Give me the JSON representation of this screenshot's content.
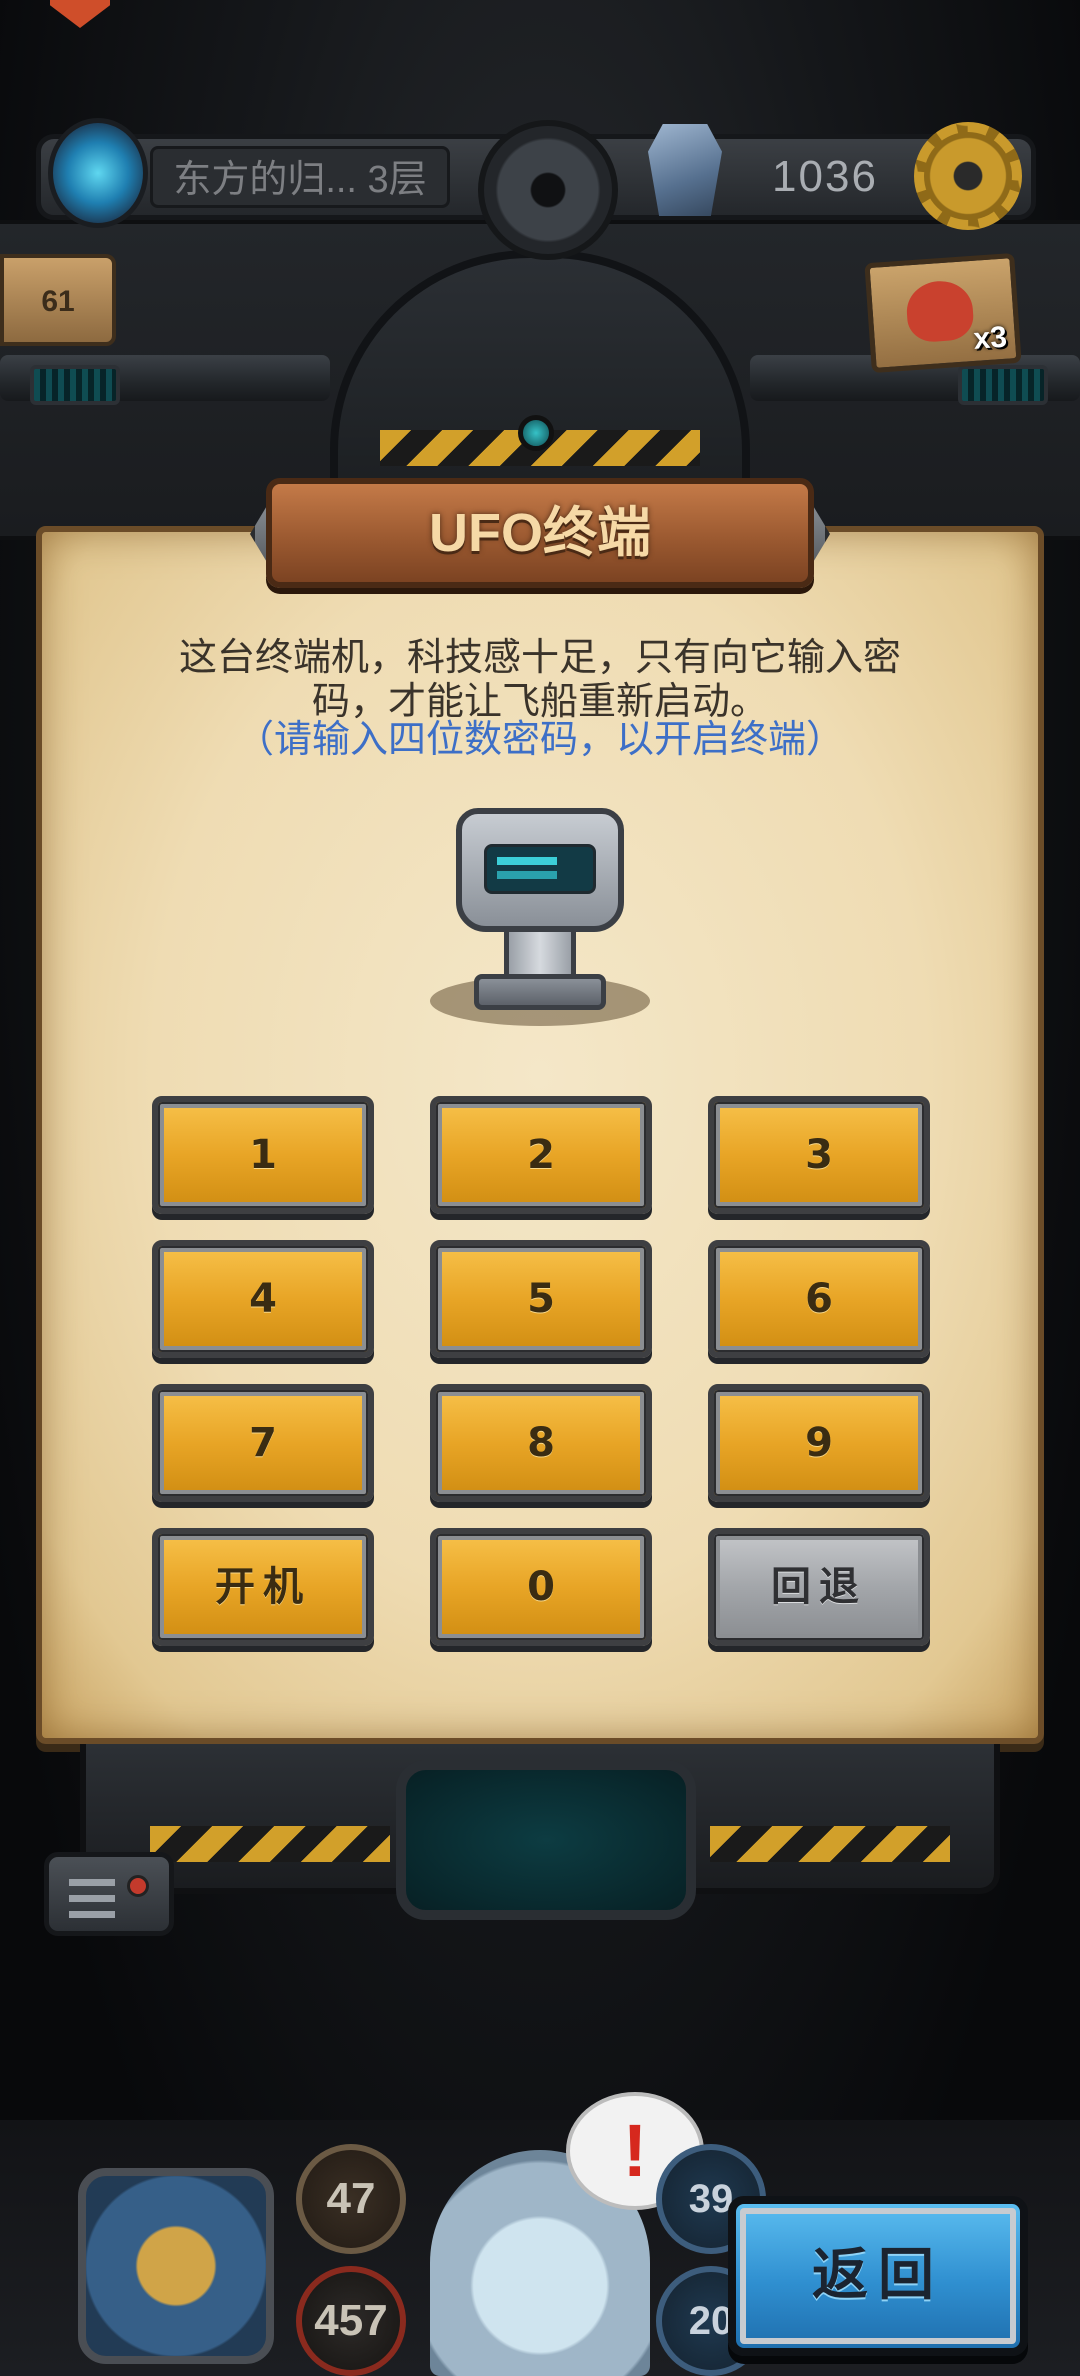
{
  "hud": {
    "floor_label": "东方的归... 3层",
    "gold_amount": "1036",
    "side_badge_value": "61",
    "fox_count": "x3"
  },
  "dialog": {
    "title": "UFO终端",
    "description_line1": "这台终端机，科技感十足，只有向它输入密",
    "description_line2": "码，才能让飞船重新启动。",
    "hint": "（请输入四位数密码，以开启终端）"
  },
  "keypad": {
    "keys": [
      "1",
      "2",
      "3",
      "4",
      "5",
      "6",
      "7",
      "8",
      "9"
    ],
    "power_label": "开机",
    "zero_label": "0",
    "backspace_label": "回退"
  },
  "hero": {
    "attack": "47",
    "hp": "457",
    "stat_right_top": "39",
    "stat_right_bottom": "20",
    "alert": "!"
  },
  "footer": {
    "back_label": "返回"
  },
  "colors": {
    "key_gold": "#e8a526",
    "key_gray": "#a3a6aa",
    "hint_blue": "#3d6fc7",
    "back_blue": "#2f8fd0"
  }
}
